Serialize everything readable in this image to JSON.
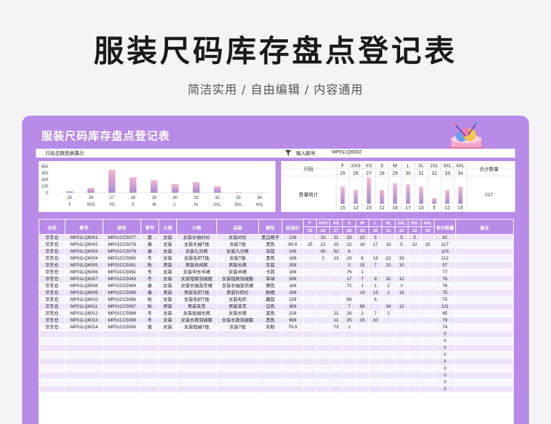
{
  "hero": {
    "title": "服装尺码库存盘点登记表",
    "subtitle": "简洁实用 / 自由编辑 / 内容通用"
  },
  "card_title": "服装尺码库存盘点登记表",
  "infobar": {
    "chart_caption": "尺码总数图表展示",
    "input_label": "输入款号",
    "input_value": "MP01LQ6002"
  },
  "colors": {
    "accent": "#b98be8",
    "bar_top": "#f2b6cf",
    "bar_bottom": "#a98ad8",
    "row_odd": "#efe4fb",
    "row_even": "#f9f5fe"
  },
  "chart_data": {
    "type": "bar",
    "categories": [
      "F",
      "XXS",
      "XS",
      "S",
      "M",
      "L",
      "XL",
      "2XL",
      "3XL",
      "4XL"
    ],
    "values": [
      25,
      72,
      348,
      234,
      192,
      132,
      163,
      99,
      8,
      0
    ],
    "ylim": [
      0,
      400
    ],
    "yticks": [
      "400",
      "300",
      "200",
      "100",
      "0"
    ],
    "value_labels": [
      "25",
      "26",
      "27",
      "28",
      "29",
      "30",
      "31",
      "32",
      "33",
      "34"
    ],
    "grid": false
  },
  "stats": {
    "size_label": "尺码",
    "sizes": [
      "F",
      "XXS",
      "XS",
      "S",
      "M",
      "L",
      "XL",
      "2XL",
      "3XL",
      "4XL"
    ],
    "codes": [
      "25",
      "26",
      "27",
      "28",
      "29",
      "30",
      "31",
      "32",
      "33",
      "34"
    ],
    "count_label": "数量统计",
    "counts": [
      15,
      12,
      23,
      12,
      18,
      17,
      15,
      5,
      12,
      15
    ],
    "counts_text": [
      "15",
      "12",
      "23",
      "12",
      "18",
      "17",
      "15",
      "5",
      "12",
      "15"
    ],
    "total_label": "合计数量",
    "total": "217"
  },
  "table": {
    "headers": [
      "仓库",
      "款号",
      "款色",
      "季节",
      "大类",
      "小类",
      "品类",
      "颜色",
      "标准价",
      "F",
      "XXS",
      "XS",
      "S",
      "M",
      "L",
      "XL",
      "2XL",
      "3XL",
      "4XL",
      "合计数量",
      "备注"
    ],
    "subheaders": [
      "25",
      "26",
      "27",
      "28",
      "29",
      "30",
      "31",
      "32",
      "33",
      "34"
    ],
    "rows": [
      [
        "华东仓",
        "MP01LQ6001",
        "MP01CC5077",
        "夏",
        "女装",
        "女装长袖衬衫",
        "女装衬衫",
        "黑白格子",
        "139",
        "",
        "10",
        "11",
        "33",
        "22",
        "5",
        "",
        "5",
        "5",
        "",
        "91",
        ""
      ],
      [
        "华东仓",
        "MP01LQ6002",
        "MP01CC5078",
        "春",
        "女装",
        "女装长袖T恤",
        "女装T恤",
        "黑色",
        "89.9",
        "15",
        "12",
        "23",
        "12",
        "18",
        "17",
        "15",
        "5",
        "12",
        "15",
        "217",
        ""
      ],
      [
        "华东仓",
        "MP01LQ6003",
        "MP01CC5079",
        "春",
        "女装",
        "女装九分裤",
        "女装九分裤",
        "深蓝",
        "149",
        "",
        "45",
        "52",
        "6",
        "",
        "",
        "",
        "",
        "",
        "",
        "103",
        ""
      ],
      [
        "华东仓",
        "MP01LQ6004",
        "MP01CC5080",
        "冬",
        "女装",
        "女装毛织T恤",
        "女装T恤",
        "黑色",
        "169",
        "",
        "2",
        "13",
        "23",
        "6",
        "13",
        "22",
        "33",
        "",
        "",
        "112",
        ""
      ],
      [
        "华东仓",
        "MP01LQ6005",
        "MP01CC5081",
        "秋",
        "男装",
        "男装休闲裤",
        "男装长裤",
        "灰蓝",
        "259",
        "",
        "",
        "",
        "2",
        "15",
        "7",
        "23",
        "10",
        "",
        "",
        "57",
        ""
      ],
      [
        "华东仓",
        "MP01LQ6006",
        "MP01CC5082",
        "冬",
        "女装",
        "女装中长半裙",
        "女装半裙",
        "卡其",
        "169",
        "",
        "",
        "",
        "76",
        "1",
        "",
        "",
        "",
        "",
        "",
        "77",
        ""
      ],
      [
        "华东仓",
        "MP01LQ6007",
        "MP01CC5083",
        "冬",
        "女装",
        "女装短款羽绒服",
        "女装短款羽绒服",
        "军绿",
        "599",
        "",
        "",
        "",
        "17",
        "7",
        "9",
        "31",
        "12",
        "",
        "",
        "76",
        ""
      ],
      [
        "华东仓",
        "MP01LQ6008",
        "MP01CC5084",
        "春",
        "女装",
        "女装长袖连衣裙",
        "女装长袖连衣裙",
        "黄色",
        "169",
        "",
        "",
        "",
        "71",
        "1",
        "1",
        "2",
        "1",
        "",
        "",
        "76",
        ""
      ],
      [
        "华东仓",
        "MP01LQ6009",
        "MP01CC5085",
        "春",
        "男装",
        "男装毛织T恤",
        "男装针织衫",
        "粉橙",
        "189",
        "",
        "",
        "",
        "",
        "19",
        "13",
        "1",
        "19",
        "",
        "",
        "75",
        ""
      ],
      [
        "华东仓",
        "MP01LQ6010",
        "MP01CC5086",
        "秋",
        "女装",
        "女装毛织T恤",
        "女装毛织",
        "藏蓝",
        "239",
        "",
        "",
        "",
        "69",
        "",
        "6",
        "",
        "",
        "",
        "",
        "75",
        ""
      ],
      [
        "华东仓",
        "MP01LQ6011",
        "MP01CC5087",
        "秋",
        "男装",
        "男装夹克",
        "男装夹克",
        "白色",
        "369",
        "",
        "",
        "",
        "7",
        "68",
        "",
        "34",
        "12",
        "",
        "",
        "121",
        ""
      ],
      [
        "华东仓",
        "MP01LQ6012",
        "MP01CC5088",
        "冬",
        "女装",
        "女装加绒长裤",
        "女装长裤",
        "蓝色",
        "219",
        "",
        "",
        "22",
        "33",
        "1",
        "7",
        "2",
        "",
        "",
        "",
        "65",
        ""
      ],
      [
        "华东仓",
        "MP01LQ6013",
        "MP01CC5089",
        "冬",
        "女装",
        "女装长款羽绒服",
        "女装长款羽绒服",
        "黑色",
        "699",
        "",
        "",
        "11",
        "25",
        "33",
        "10",
        "",
        "",
        "",
        "",
        "79",
        ""
      ],
      [
        "华东仓",
        "MP01LQ6014",
        "MP01CC5090",
        "夏",
        "女装",
        "女装短袖T恤",
        "女装T恤",
        "灰粉",
        "79.9",
        "",
        "",
        "73",
        "1",
        "",
        "",
        "",
        "",
        "",
        "",
        "74",
        ""
      ],
      [
        "",
        "",
        "",
        "",
        "",
        "",
        "",
        "",
        "",
        "",
        "",
        "",
        "",
        "",
        "",
        "",
        "",
        "",
        "",
        "0",
        ""
      ],
      [
        "",
        "",
        "",
        "",
        "",
        "",
        "",
        "",
        "",
        "",
        "",
        "",
        "",
        "",
        "",
        "",
        "",
        "",
        "",
        "0",
        ""
      ],
      [
        "",
        "",
        "",
        "",
        "",
        "",
        "",
        "",
        "",
        "",
        "",
        "",
        "",
        "",
        "",
        "",
        "",
        "",
        "",
        "0",
        ""
      ],
      [
        "",
        "",
        "",
        "",
        "",
        "",
        "",
        "",
        "",
        "",
        "",
        "",
        "",
        "",
        "",
        "",
        "",
        "",
        "",
        "0",
        ""
      ],
      [
        "",
        "",
        "",
        "",
        "",
        "",
        "",
        "",
        "",
        "",
        "",
        "",
        "",
        "",
        "",
        "",
        "",
        "",
        "",
        "0",
        ""
      ],
      [
        "",
        "",
        "",
        "",
        "",
        "",
        "",
        "",
        "",
        "",
        "",
        "",
        "",
        "",
        "",
        "",
        "",
        "",
        "",
        "0",
        ""
      ],
      [
        "",
        "",
        "",
        "",
        "",
        "",
        "",
        "",
        "",
        "",
        "",
        "",
        "",
        "",
        "",
        "",
        "",
        "",
        "",
        "0",
        ""
      ],
      [
        "",
        "",
        "",
        "",
        "",
        "",
        "",
        "",
        "",
        "",
        "",
        "",
        "",
        "",
        "",
        "",
        "",
        "",
        "",
        "0",
        ""
      ],
      [
        "",
        "",
        "",
        "",
        "",
        "",
        "",
        "",
        "",
        "",
        "",
        "",
        "",
        "",
        "",
        "",
        "",
        "",
        "",
        "0",
        ""
      ]
    ]
  }
}
